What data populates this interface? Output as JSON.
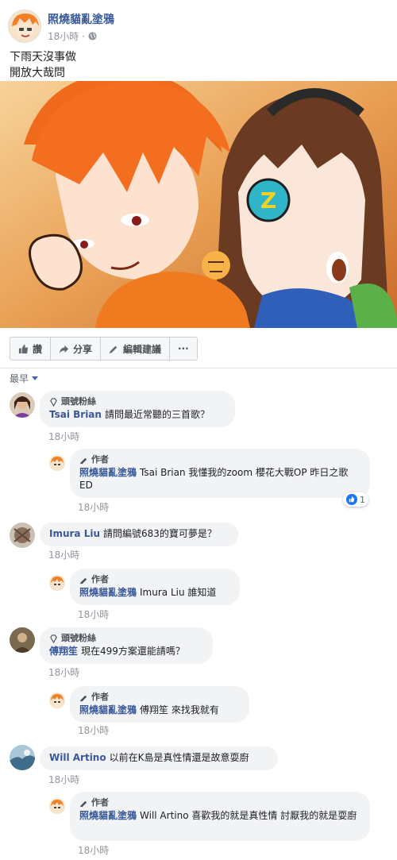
{
  "post": {
    "author": "照燒貓亂塗鴉",
    "time": "18小時",
    "lines": [
      "下雨天沒事做",
      "開放大哉問"
    ]
  },
  "actions": {
    "like": "讚",
    "share": "分享",
    "edit": "編輯建議",
    "more": "···"
  },
  "sort_label": "最早",
  "colors": {
    "link": "#385898",
    "bubble": "#f2f3f5",
    "accent": "#1877f2"
  },
  "comments": [
    {
      "badge": "頭號粉絲",
      "name": "Tsai Brian",
      "text": "請問最近常聽的三首歌？",
      "time": "18小時",
      "reply": {
        "badge": "作者",
        "name": "照燒貓亂塗鴉",
        "text": "Tsai Brian 我懂我的zoom 櫻花大戰OP 昨日之歌ED",
        "time": "18小時",
        "reactions": "1"
      }
    },
    {
      "name": "Imura Liu",
      "text": "請問編號683的寶可夢是？",
      "time": "18小時",
      "reply": {
        "badge": "作者",
        "name": "照燒貓亂塗鴉",
        "text": "Imura Liu 誰知道",
        "time": "18小時"
      }
    },
    {
      "badge": "頭號粉絲",
      "name": "傅翔笙",
      "text": "現在499方案還能請嗎？",
      "time": "18小時",
      "reply": {
        "badge": "作者",
        "name": "照燒貓亂塗鴉",
        "text": "傅翔笙 來找我就有",
        "time": "18小時"
      }
    },
    {
      "name": "Will Artino",
      "text": "以前在K島是真性情還是故意耍廚",
      "time": "18小時",
      "reply": {
        "badge": "作者",
        "name": "照燒貓亂塗鴉",
        "text": "Will Artino 喜歡我的就是真性情 討厭我的就是耍廚",
        "time": "18小時"
      }
    }
  ]
}
